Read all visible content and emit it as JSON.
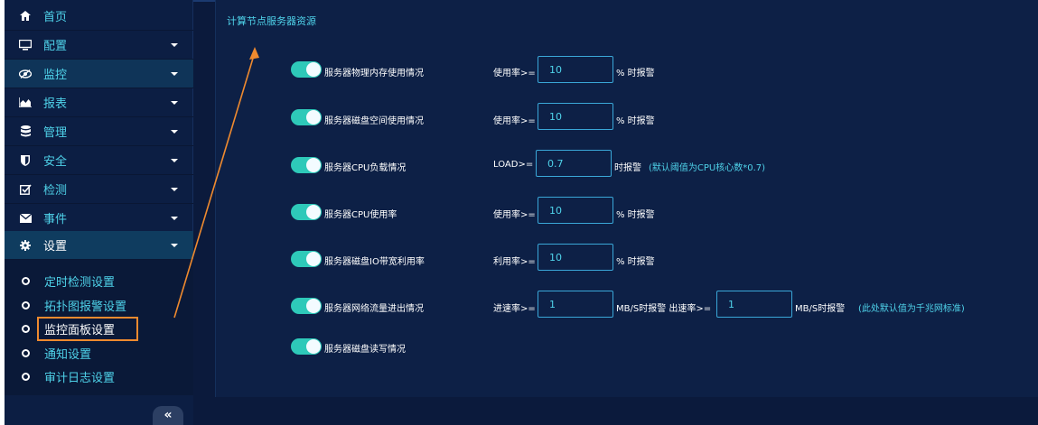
{
  "sidebar": {
    "items": [
      {
        "label": "首页",
        "icon": "home-icon",
        "caret": false
      },
      {
        "label": "配置",
        "icon": "monitor-icon",
        "caret": true
      },
      {
        "label": "监控",
        "icon": "eye-icon",
        "caret": true
      },
      {
        "label": "报表",
        "icon": "area-chart-icon",
        "caret": true
      },
      {
        "label": "管理",
        "icon": "database-icon",
        "caret": true
      },
      {
        "label": "安全",
        "icon": "shield-icon",
        "caret": true
      },
      {
        "label": "检测",
        "icon": "checkbox-icon",
        "caret": true
      },
      {
        "label": "事件",
        "icon": "envelope-icon",
        "caret": true
      },
      {
        "label": "设置",
        "icon": "gear-icon",
        "caret": true
      }
    ],
    "sub_items": [
      {
        "label": "定时检测设置"
      },
      {
        "label": "拓扑图报警设置"
      },
      {
        "label": "监控面板设置"
      },
      {
        "label": "通知设置"
      },
      {
        "label": "审计日志设置"
      }
    ],
    "collapse_label": "«"
  },
  "main": {
    "title": "计算节点服务器资源",
    "rows": [
      {
        "label": "服务器物理内存使用情况",
        "field_label": "使用率>=",
        "value": "10",
        "suffix": "% 时报警"
      },
      {
        "label": "服务器磁盘空间使用情况",
        "field_label": "使用率>=",
        "value": "10",
        "suffix": "% 时报警"
      },
      {
        "label": "服务器CPU负载情况",
        "field_label": "LOAD>=",
        "value": "0.7",
        "suffix": "时报警",
        "hint": "(默认阈值为CPU核心数*0.7)"
      },
      {
        "label": "服务器CPU使用率",
        "field_label": "使用率>=",
        "value": "10",
        "suffix": "% 时报警"
      },
      {
        "label": "服务器磁盘IO带宽利用率",
        "field_label": "利用率>=",
        "value": "10",
        "suffix": "% 时报警"
      },
      {
        "label": "服务器网络流量进出情况",
        "field_label": "进速率>=",
        "value": "1",
        "suffix": "MB/S时报警 出速率>=",
        "value2": "1",
        "suffix2": "MB/S时报警",
        "hint": "(此处默认值为千兆网标准)"
      },
      {
        "label": "服务器磁盘读写情况"
      }
    ]
  },
  "colors": {
    "accent": "#4fd3ea",
    "toggle_on": "#2ec9b9",
    "highlight": "#ef8a2f",
    "background": "#0b1a3c"
  }
}
